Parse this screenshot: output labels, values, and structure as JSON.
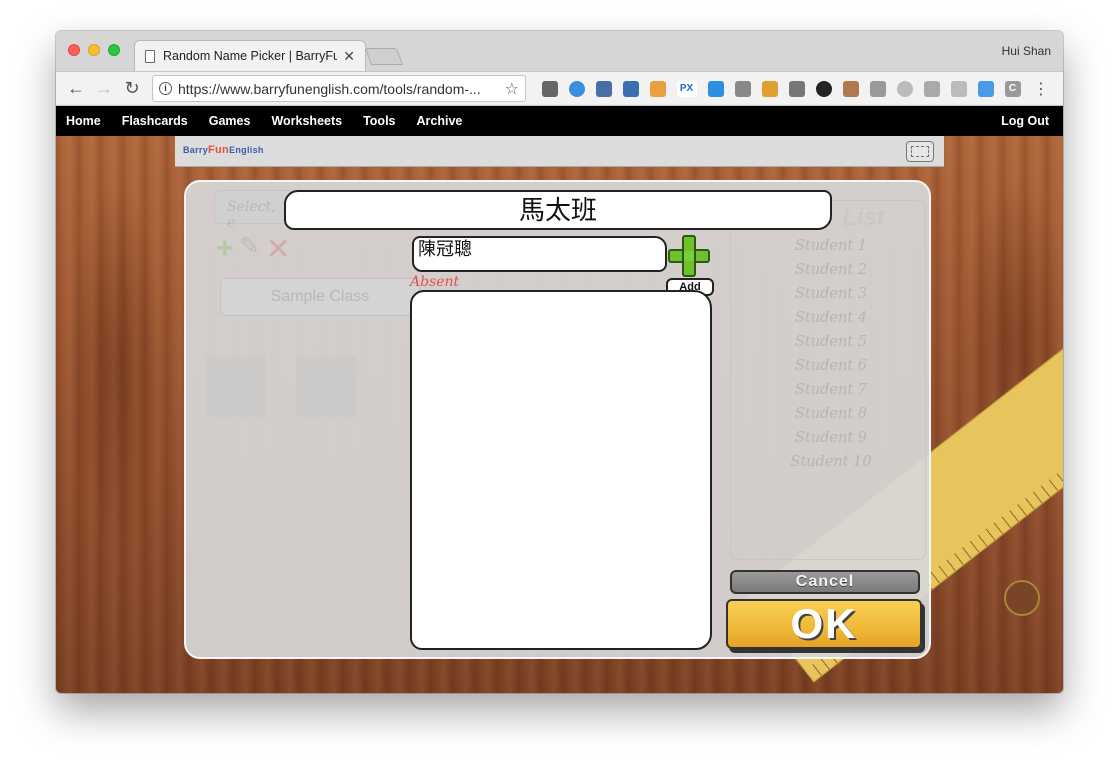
{
  "browser": {
    "tab_title": "Random Name Picker | BarryFu",
    "tab_close": "✕",
    "profile_name": "Hui Shan",
    "url": "https://www.barryfunenglish.com/tools/random-...",
    "back_glyph": "←",
    "forward_glyph": "→",
    "reload_glyph": "↻",
    "info_glyph": "i",
    "star_glyph": "☆",
    "menu_glyph": "⋮",
    "px_ext_label": "PX",
    "c_ext_label": "C"
  },
  "site_nav": {
    "home": "Home",
    "flashcards": "Flashcards",
    "games": "Games",
    "worksheets": "Worksheets",
    "tools": "Tools",
    "archive": "Archive",
    "logout": "Log Out"
  },
  "header": {
    "logo_barry": "Barry",
    "logo_fun": "Fun",
    "logo_english": "English"
  },
  "background": {
    "select_placeholder": "Select, e",
    "class_name": "Sample Class",
    "list_title": "List",
    "students": [
      "Student 1",
      "Student 2",
      "Student 3",
      "Student 4",
      "Student 5",
      "Student 6",
      "Student 7",
      "Student 8",
      "Student 9",
      "Student 10"
    ]
  },
  "dialog": {
    "class_title": "馬太班",
    "name_input_value": "陳冠聰",
    "add_label": "Add",
    "absent_label": "Absent",
    "cancel_label": "Cancel",
    "ok_label": "OK"
  }
}
